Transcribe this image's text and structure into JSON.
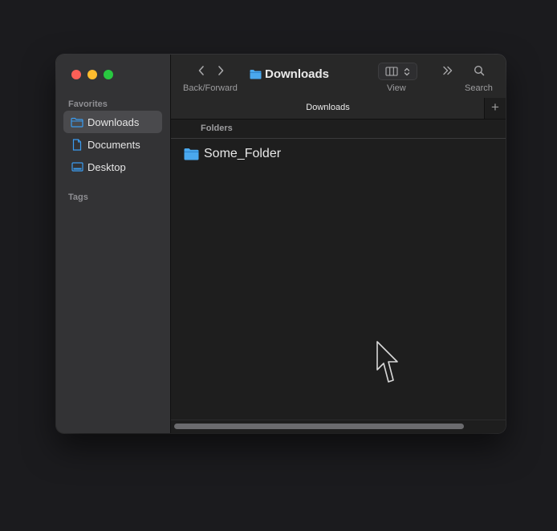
{
  "window": {
    "title": "Downloads"
  },
  "toolbar": {
    "back_forward_label": "Back/Forward",
    "view_label": "View",
    "search_label": "Search",
    "title": "Downloads"
  },
  "tabbar": {
    "tab_title": "Downloads",
    "add_symbol": "+"
  },
  "sidebar": {
    "favorites_label": "Favorites",
    "tags_label": "Tags",
    "items": [
      {
        "label": "Downloads",
        "icon": "folder-icon",
        "selected": true
      },
      {
        "label": "Documents",
        "icon": "document-icon",
        "selected": false
      },
      {
        "label": "Desktop",
        "icon": "desktop-icon",
        "selected": false
      }
    ]
  },
  "content": {
    "section_header": "Folders",
    "items": [
      {
        "name": "Some_Folder",
        "icon": "folder-icon"
      }
    ]
  },
  "colors": {
    "accent": "#3b9cf0",
    "folder": "#4aa8ee",
    "close": "#fe5f57",
    "minimize": "#febc2e",
    "maximize": "#28c840"
  }
}
